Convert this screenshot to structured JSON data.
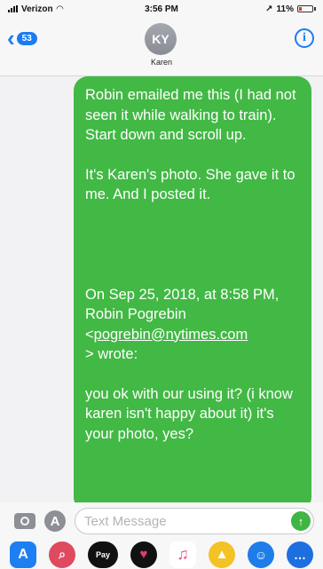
{
  "status_bar": {
    "carrier": "Verizon",
    "time": "3:56 PM",
    "battery": "11%"
  },
  "header": {
    "back_count": "53",
    "avatar_initials": "KY",
    "contact_name": "Karen"
  },
  "message": {
    "paragraphs": [
      "Robin emailed me this (I had not seen it while walking to train). Start down and scroll up.",
      "It's Karen's photo.  She gave it to me. And I posted it.",
      "On Sep 25, 2018, at 8:58 PM, Robin Pogrebin",
      "pogrebin@nytimes.com",
      "you ok with our using it? (i know karen isn't happy about it) it's your photo, yes?"
    ],
    "email_open": "<",
    "email_close": "> wrote:"
  },
  "input": {
    "placeholder": "Text Message"
  },
  "colors": {
    "bubble": "#42b845",
    "accent": "#1a7cf5"
  },
  "icons": {
    "back": "chevron-left-icon",
    "info": "info-icon",
    "camera": "camera-icon",
    "apps": "app-store-icon",
    "send": "send-arrow-icon"
  },
  "app_drawer": [
    "app-store",
    "search",
    "apple-pay",
    "digital-touch",
    "music",
    "animoji",
    "emoji",
    "more"
  ]
}
